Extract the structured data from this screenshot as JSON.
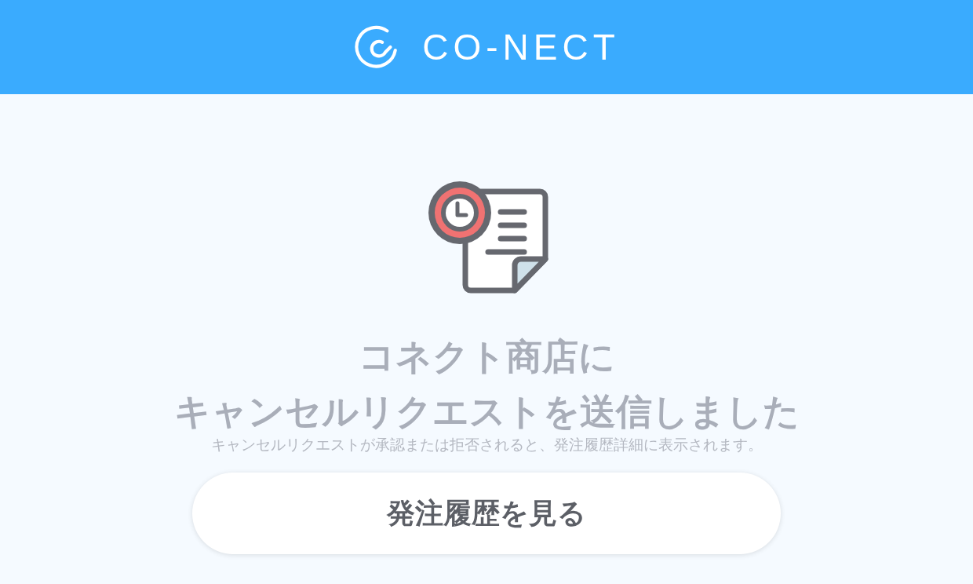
{
  "header": {
    "logo_text": "CO-NECT"
  },
  "message": {
    "title_lines": [
      "コネクト商店に",
      "キャンセルリクエストを送信しました"
    ],
    "note": "キャンセルリクエストが承認または拒否されると、発注履歴詳細に表示されます。"
  },
  "button": {
    "label": "発注履歴を見る"
  }
}
